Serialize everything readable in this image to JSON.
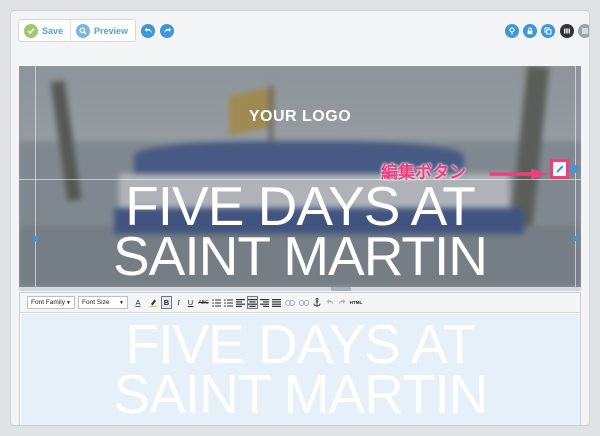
{
  "toolbar": {
    "save_label": "Save",
    "preview_label": "Preview",
    "undo_icon": "undo-icon",
    "redo_icon": "redo-icon",
    "right_icons": [
      "map-pin-icon",
      "lock-icon",
      "copy-icon",
      "columns-icon",
      "grid-icon"
    ]
  },
  "canvas": {
    "logo_text": "YOUR LOGO",
    "headline_line1": "FIVE DAYS AT",
    "headline_line2": "SAINT MARTIN",
    "annotation_text": "編集ボタン",
    "annotation_color": "#f03a7b",
    "edit_button_icon": "pencil-icon",
    "small_icons": [
      "trash-icon",
      "settings-icon"
    ]
  },
  "editor": {
    "font_family_label": "Font Family",
    "font_size_label": "Font Size",
    "buttons": [
      "text-color",
      "highlight-color",
      "bold",
      "italic",
      "underline",
      "strikethrough",
      "unordered-list",
      "ordered-list",
      "align-left",
      "align-center",
      "align-right",
      "justify",
      "link",
      "unlink",
      "anchor",
      "undo",
      "redo",
      "html"
    ],
    "button_glyphs": {
      "text_color": "A",
      "bold": "B",
      "italic": "I",
      "underline": "U",
      "strike": "ABC",
      "html": "HTML"
    },
    "text_line1": "FIVE DAYS AT",
    "text_line2": "SAINT MARTIN"
  },
  "colors": {
    "accent": "#3d97d8",
    "save_green": "#9cc96b",
    "editor_bg": "#e5f0f8"
  }
}
